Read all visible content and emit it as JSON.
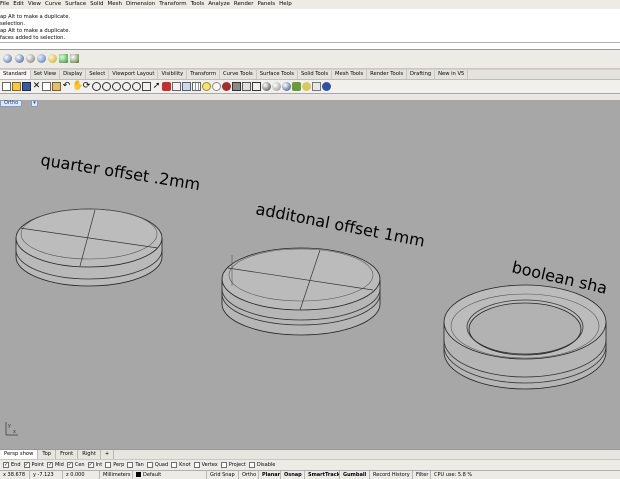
{
  "menu": [
    "File",
    "Edit",
    "View",
    "Curve",
    "Surface",
    "Solid",
    "Mesh",
    "Dimension",
    "Transform",
    "Tools",
    "Analyze",
    "Render",
    "Panels",
    "Help"
  ],
  "history": [
    "ap Alt to make a duplicate.",
    "selection.",
    "ap Alt to make a duplicate.",
    "faces added to selection."
  ],
  "tabs": [
    "Standard",
    "Set View",
    "Display",
    "Select",
    "Viewport Layout",
    "Visibility",
    "Transform",
    "Curve Tools",
    "Surface Tools",
    "Solid Tools",
    "Mesh Tools",
    "Render Tools",
    "Drafting",
    "New in V5"
  ],
  "viewport": {
    "title": "Ortho",
    "labels": [
      "quarter offset .2mm",
      "additonal offset 1mm",
      "boolean sha"
    ],
    "axis_y": "y",
    "axis_x": "x"
  },
  "view_tabs": [
    "Persp show",
    "Top",
    "Front",
    "Right",
    "+"
  ],
  "osnaps": [
    {
      "label": "End",
      "checked": true
    },
    {
      "label": "Point",
      "checked": true
    },
    {
      "label": "Mid",
      "checked": true
    },
    {
      "label": "Cen",
      "checked": true
    },
    {
      "label": "Int",
      "checked": true
    },
    {
      "label": "Perp",
      "checked": false
    },
    {
      "label": "Tan",
      "checked": false
    },
    {
      "label": "Quad",
      "checked": false
    },
    {
      "label": "Knot",
      "checked": false
    },
    {
      "label": "Vertex",
      "checked": false
    },
    {
      "label": "Project",
      "checked": false
    },
    {
      "label": "Disable",
      "checked": false
    }
  ],
  "status": {
    "x": "x 38.678",
    "y": "y -7.123",
    "z": "z 0.000",
    "units": "Millimeters",
    "layer": "Default",
    "toggles": [
      "Grid Snap",
      "Ortho",
      "Planar",
      "Osnap",
      "SmartTrack",
      "Gumball",
      "Record History",
      "Filter"
    ],
    "cpu": "CPU use: 5.8 %"
  }
}
